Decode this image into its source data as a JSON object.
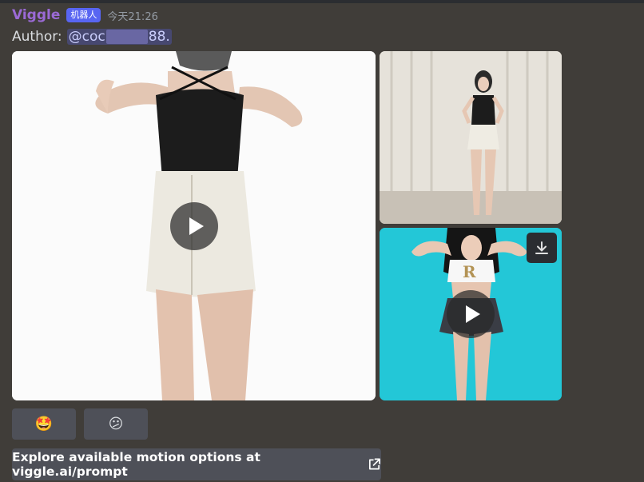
{
  "message": {
    "username": "Viggle",
    "bot_tag": "机器人",
    "timestamp": "今天21:26",
    "author_label": "Author:",
    "mention_prefix": "@coc",
    "mention_suffix": "88."
  },
  "media": [
    {
      "type": "video",
      "description": "dancer in black top and white skirt on white background"
    },
    {
      "type": "image",
      "description": "full body woman in front of white curtains"
    },
    {
      "type": "video",
      "description": "dancer on cyan background"
    }
  ],
  "reactions": [
    {
      "emoji": "🤩"
    },
    {
      "emoji": "😕"
    }
  ],
  "link_button": {
    "label": "Explore available motion options at viggle.ai/prompt"
  },
  "colors": {
    "background": "#403d39",
    "username": "#9b6ad6",
    "bot_tag": "#5865f2",
    "button": "#4e5058"
  }
}
